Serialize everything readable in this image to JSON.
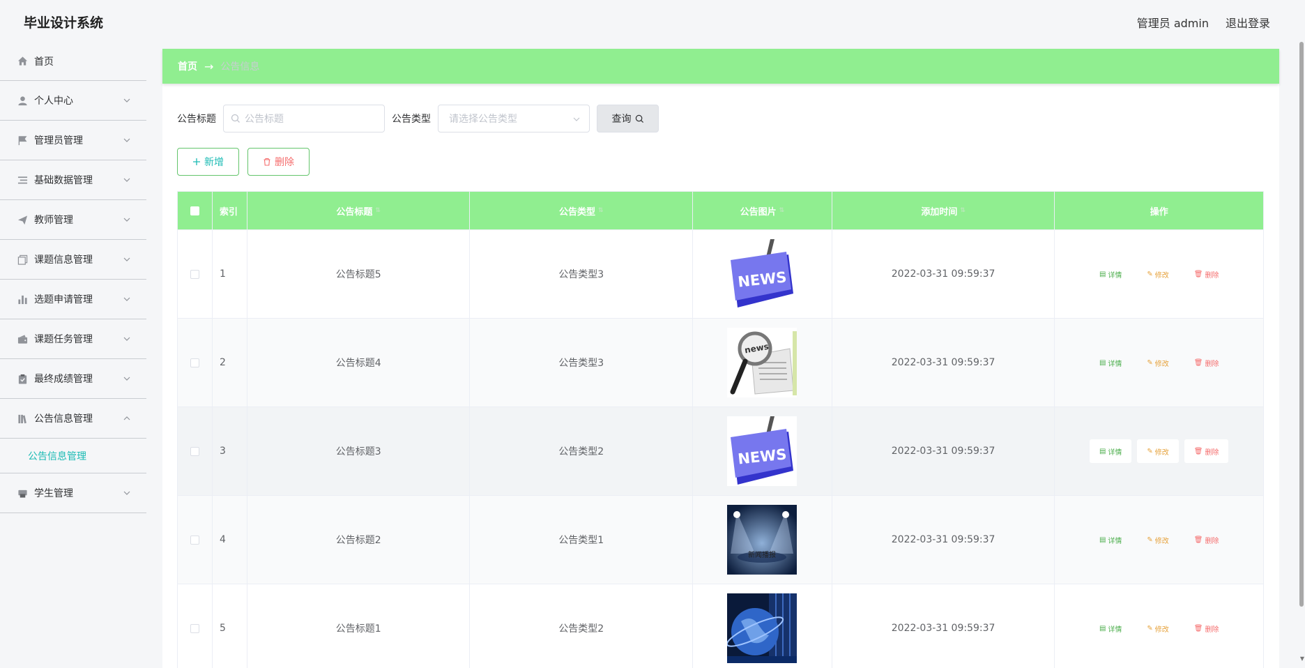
{
  "header": {
    "brand": "毕业设计系统",
    "user_label": "管理员 admin",
    "logout_label": "退出登录"
  },
  "sidebar": {
    "items": [
      {
        "label": "首页",
        "icon": "home-icon"
      },
      {
        "label": "个人中心",
        "icon": "user-icon"
      },
      {
        "label": "管理员管理",
        "icon": "flag-icon"
      },
      {
        "label": "基础数据管理",
        "icon": "list-icon"
      },
      {
        "label": "教师管理",
        "icon": "paper-plane-icon"
      },
      {
        "label": "课题信息管理",
        "icon": "copy-icon"
      },
      {
        "label": "选题申请管理",
        "icon": "bar-chart-icon"
      },
      {
        "label": "课题任务管理",
        "icon": "wallet-icon"
      },
      {
        "label": "最终成绩管理",
        "icon": "clipboard-icon"
      },
      {
        "label": "公告信息管理",
        "icon": "books-icon"
      },
      {
        "label": "学生管理",
        "icon": "printer-icon"
      }
    ],
    "submenu_label": "公告信息管理"
  },
  "breadcrumb": {
    "home": "首页",
    "separator": "→",
    "current": "公告信息"
  },
  "search": {
    "title_label": "公告标题",
    "title_placeholder": "公告标题",
    "type_label": "公告类型",
    "type_placeholder": "请选择公告类型",
    "query_label": "查询"
  },
  "actions": {
    "add_label": "新增",
    "delete_label": "删除"
  },
  "table": {
    "headers": {
      "index": "索引",
      "title": "公告标题",
      "type": "公告类型",
      "image": "公告图片",
      "time": "添加时间",
      "ops": "操作"
    },
    "op_labels": {
      "detail": "详情",
      "edit": "修改",
      "delete": "删除"
    },
    "rows": [
      {
        "index": "1",
        "title": "公告标题5",
        "type": "公告类型3",
        "time": "2022-03-31 09:59:37",
        "image": "news-keyboard"
      },
      {
        "index": "2",
        "title": "公告标题4",
        "type": "公告类型3",
        "time": "2022-03-31 09:59:37",
        "image": "news-magnifier"
      },
      {
        "index": "3",
        "title": "公告标题3",
        "type": "公告类型2",
        "time": "2022-03-31 09:59:37",
        "image": "news-keyboard"
      },
      {
        "index": "4",
        "title": "公告标题2",
        "type": "公告类型1",
        "time": "2022-03-31 09:59:37",
        "image": "news-stage",
        "image_text": "新闻播报"
      },
      {
        "index": "5",
        "title": "公告标题1",
        "type": "公告类型2",
        "time": "2022-03-31 09:59:37",
        "image": "news-globe"
      }
    ]
  },
  "colors": {
    "accent_green": "#90ee90",
    "teal": "#1cbbb4",
    "danger": "#f56c6c",
    "warning": "#e6a23c"
  }
}
